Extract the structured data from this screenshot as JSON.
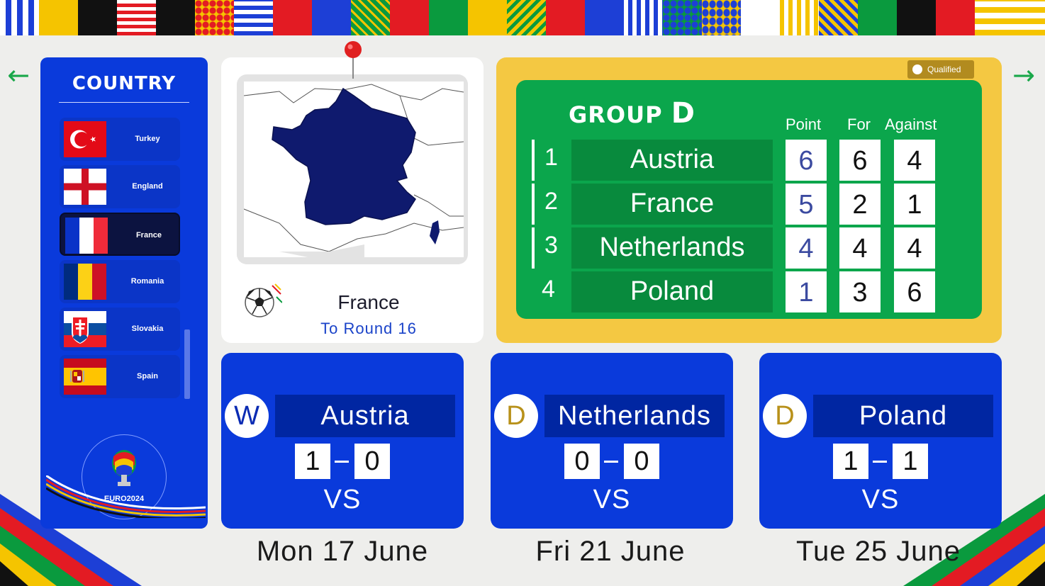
{
  "nav": {
    "prev_icon": "arrow-left-icon",
    "next_icon": "arrow-right-icon",
    "prev_glyph": "←",
    "next_glyph": "→"
  },
  "country_panel": {
    "title": "COUNTRY",
    "countries": [
      {
        "name": "Turkey",
        "selected": false
      },
      {
        "name": "England",
        "selected": false
      },
      {
        "name": "France",
        "selected": true
      },
      {
        "name": "Romania",
        "selected": false
      },
      {
        "name": "Slovakia",
        "selected": false
      },
      {
        "name": "Spain",
        "selected": false
      }
    ],
    "logo_text": "EURO2024"
  },
  "map_card": {
    "country": "France",
    "status": "To Round 16"
  },
  "group": {
    "badge": "Qualified",
    "title": "GROUP",
    "letter": "D",
    "headers": {
      "point": "Point",
      "for": "For",
      "against": "Against"
    },
    "rows": [
      {
        "rank": "1",
        "team": "Austria",
        "point": "6",
        "for": "6",
        "against": "4",
        "qualified": true
      },
      {
        "rank": "2",
        "team": "France",
        "point": "5",
        "for": "2",
        "against": "1",
        "qualified": true
      },
      {
        "rank": "3",
        "team": "Netherlands",
        "point": "4",
        "for": "4",
        "against": "4",
        "qualified": true
      },
      {
        "rank": "4",
        "team": "Poland",
        "point": "1",
        "for": "3",
        "against": "6",
        "qualified": false
      }
    ]
  },
  "matches": [
    {
      "result": "W",
      "opponent": "Austria",
      "score_home": "1",
      "score_away": "0",
      "vs": "VS",
      "date": "Mon 17 June"
    },
    {
      "result": "D",
      "opponent": "Netherlands",
      "score_home": "0",
      "score_away": "0",
      "vs": "VS",
      "date": "Fri 21 June"
    },
    {
      "result": "D",
      "opponent": "Poland",
      "score_home": "1",
      "score_away": "1",
      "vs": "VS",
      "date": "Tue 25 June"
    }
  ],
  "colors": {
    "panel_blue": "#0a3adb",
    "group_yellow": "#f4c842",
    "group_green": "#0ba64c",
    "france_navy": "#0f1a6e",
    "nav_green": "#1aa84a"
  }
}
